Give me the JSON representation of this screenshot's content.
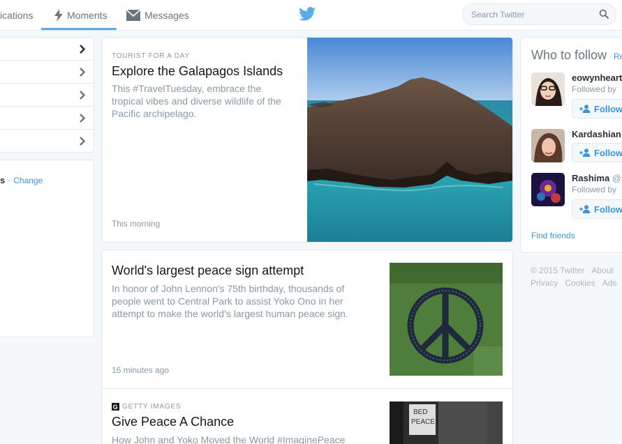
{
  "nav": {
    "items": [
      {
        "label": "ications",
        "icon": "bell-icon"
      },
      {
        "label": "Moments",
        "icon": "lightning-icon",
        "active": true
      },
      {
        "label": "Messages",
        "icon": "envelope-icon"
      }
    ],
    "logo": "twitter-bird-icon",
    "search_placeholder": "Search Twitter"
  },
  "left": {
    "rows": 5,
    "trends_head": {
      "cut": "s",
      "separator": "·",
      "change": "Change"
    }
  },
  "cards": [
    {
      "eyebrow": "TOURIST FOR A DAY",
      "title": "Explore the Galapagos Islands",
      "description": "This #TravelTuesday, embrace the tropical vibes and diverse wildlife of the Pacific archipelago.",
      "time": "This morning"
    },
    {
      "title": "World's largest peace sign attempt",
      "description": "In honor of John Lennon's 75th birthday, thousands of people went to Central Park to assist Yoko Ono in her attempt to make the world's largest human peace sign.",
      "time": "16 minutes ago"
    },
    {
      "source_badge": "g",
      "eyebrow": "GETTY IMAGES",
      "title": "Give Peace A Chance",
      "description": "How John and Yoko Moved the World #ImaginePeace",
      "sign_line1": "BED",
      "sign_line2": "PEACE"
    }
  ],
  "who_to_follow": {
    "title": "Who to follow",
    "separator": "·",
    "refresh": "Re",
    "users": [
      {
        "name": "eowynheart",
        "handle": "",
        "followed": "Followed by",
        "follow_label": "Follow"
      },
      {
        "name": "Kardashian",
        "handle": "",
        "followed": "",
        "follow_label": "Follow"
      },
      {
        "name": "Rashima",
        "handle": "@s",
        "followed": "Followed by",
        "follow_label": "Follow"
      }
    ],
    "find_friends": "Find friends"
  },
  "footer": {
    "line1": [
      "© 2015 Twitter",
      "About"
    ],
    "line2": [
      "Privacy",
      "Cookies",
      "Ads"
    ]
  },
  "colors": {
    "accent": "#5ea9dd",
    "link": "#3b94d9",
    "muted": "#8899a6"
  }
}
